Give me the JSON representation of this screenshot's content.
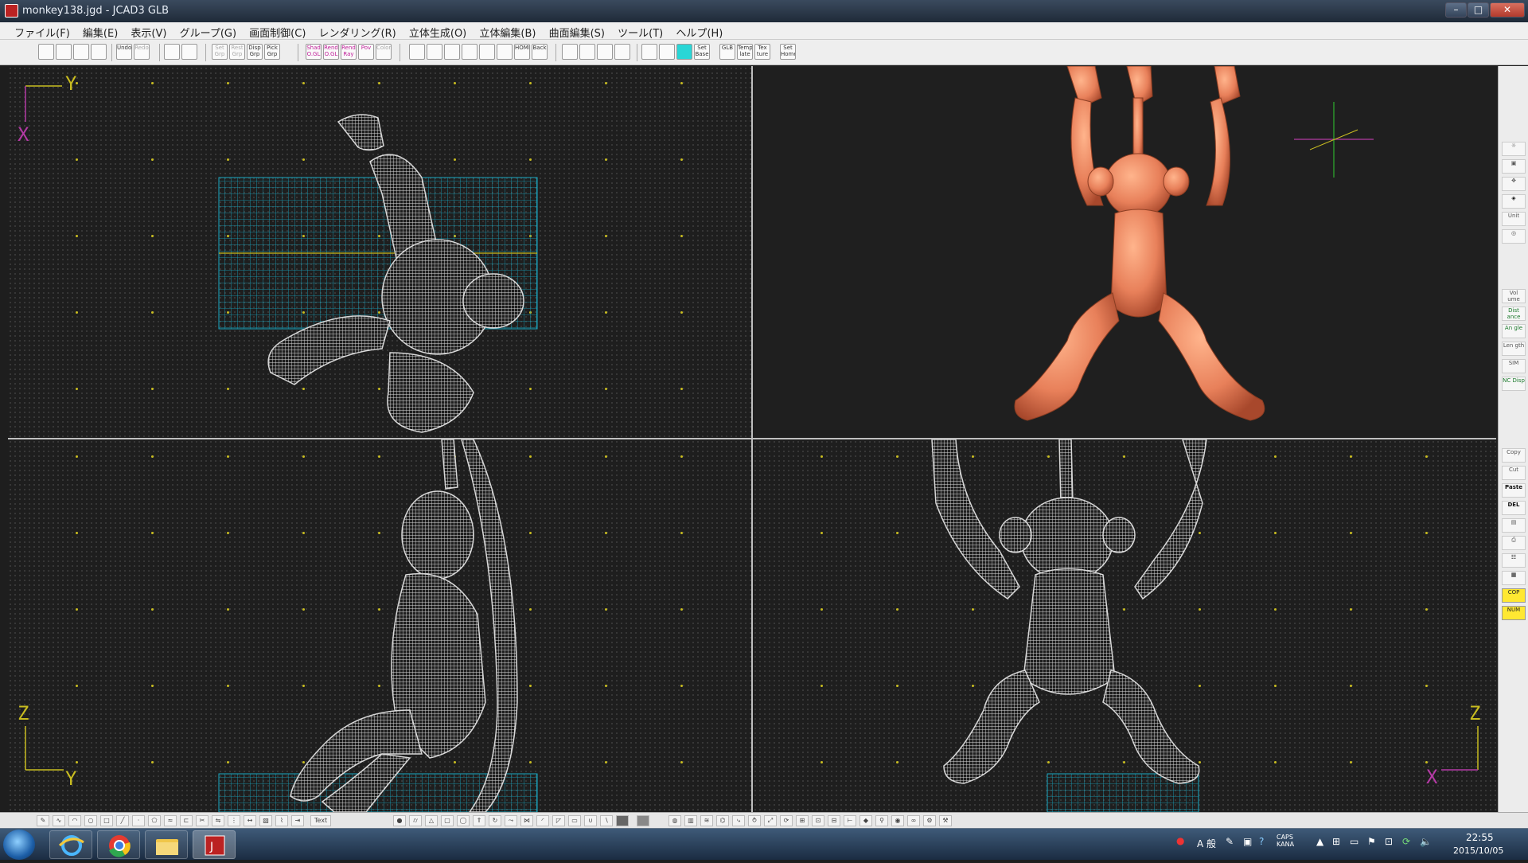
{
  "window": {
    "title": "monkey138.jgd - JCAD3 GLB"
  },
  "menu": [
    "ファイル(F)",
    "編集(E)",
    "表示(V)",
    "グループ(G)",
    "画面制御(C)",
    "レンダリング(R)",
    "立体生成(O)",
    "立体編集(B)",
    "曲面編集(S)",
    "ツール(T)",
    "ヘルプ(H)"
  ],
  "toolbar": {
    "undo": "Undo",
    "redo": "Redo",
    "set_grp": "Set Grp",
    "rest_grp": "Rest Grp",
    "disp_grp": "Disp Grp",
    "pick_grp": "Pick Grp",
    "shad_ogl": "Shad O.GL",
    "rend_ogl": "Rend O.GL",
    "rend_ray": "Rend Ray",
    "pov": "Pov",
    "color": "Color",
    "home": "HOME",
    "back": "Back",
    "set_base": "Set Base",
    "glb": "GLB",
    "template": "Temp late",
    "texture": "Tex ture",
    "set_home": "Set Home"
  },
  "viewports": {
    "top_left": {
      "axis_h": "Y",
      "axis_v": "X"
    },
    "bottom_left": {
      "axis_v": "Z",
      "axis_h": "Y"
    },
    "bottom_right": {
      "axis_v": "Z",
      "axis_h": "X"
    }
  },
  "right_panel": {
    "unit": "Unit",
    "volume": "Vol ume",
    "distance": "Dist ance",
    "angle": "An gle",
    "length": "Len gth",
    "sim": "SIM",
    "nc_disp": "NC Disp",
    "copy": "Copy",
    "cut": "Cut",
    "paste": "Paste",
    "del": "DEL",
    "cop": "COP",
    "num": "NUM"
  },
  "bottom_toolbar": {
    "text": "Text"
  },
  "taskbar": {
    "ime": "A 般",
    "caps": "CAPS KANA",
    "time": "22:55",
    "date": "2015/10/05"
  },
  "colors": {
    "grid_cyan": "#1aa8c2",
    "model_white": "#d8d8d8",
    "render_orange": "#e8805a",
    "grid_dot": "#c9bd20"
  }
}
